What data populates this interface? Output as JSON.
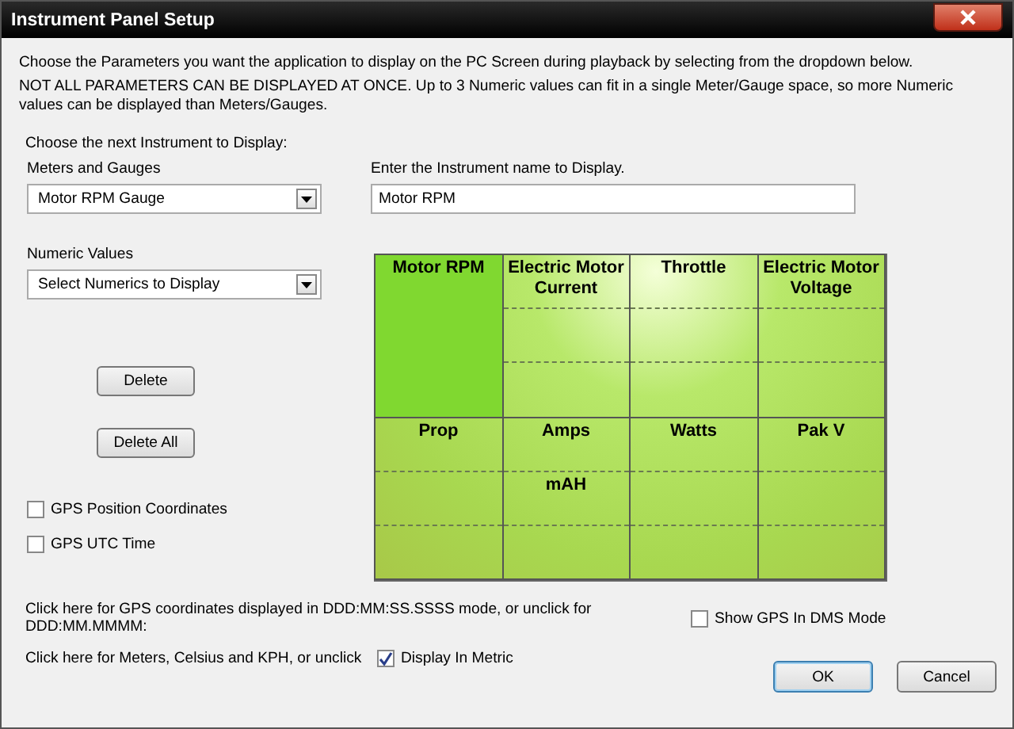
{
  "window": {
    "title": "Instrument Panel Setup"
  },
  "intro": [
    "Choose the Parameters  you want the application to display on the PC Screen during playback by selecting from the dropdown below.",
    "NOT ALL PARAMETERS CAN BE DISPLAYED AT ONCE.  Up to 3 Numeric values can fit in a single Meter/Gauge space, so more Numeric values can be displayed than Meters/Gauges."
  ],
  "choose_label": "Choose the next Instrument to Display:",
  "meters": {
    "label": "Meters and Gauges",
    "value": "Motor RPM Gauge"
  },
  "name_field": {
    "label": "Enter the Instrument name to Display.",
    "value": "Motor RPM"
  },
  "numerics": {
    "label": "Numeric Values",
    "value": "Select Numerics to Display"
  },
  "buttons": [
    "Delete",
    "Delete All"
  ],
  "checkboxes": [
    {
      "label": "GPS Position Coordinates",
      "checked": false
    },
    {
      "label": "GPS UTC Time",
      "checked": false
    }
  ],
  "panel": [
    {
      "label": "Motor RPM",
      "selected": true
    },
    {
      "label": "Electric Motor Current",
      "selected": false
    },
    {
      "label": "Throttle",
      "selected": false
    },
    {
      "label": "Electric Motor Voltage",
      "selected": false
    },
    {
      "label": "Prop",
      "selected": false
    },
    {
      "label": "Amps",
      "numerics": [
        "mAH"
      ],
      "selected": false
    },
    {
      "label": "Watts",
      "selected": false
    },
    {
      "label": "Pak V",
      "selected": false
    }
  ],
  "options": [
    {
      "text": "Click here for GPS coordinates displayed in DDD:MM:SS.SSSS mode, or unclick for DDD:MM.MMMM:",
      "label": "Show GPS In DMS Mode",
      "checked": false
    },
    {
      "text": "Click here for Meters, Celsius and KPH, or unclick",
      "label": "Display In Metric",
      "checked": true
    }
  ],
  "dialog_buttons": [
    "OK",
    "Cancel"
  ]
}
